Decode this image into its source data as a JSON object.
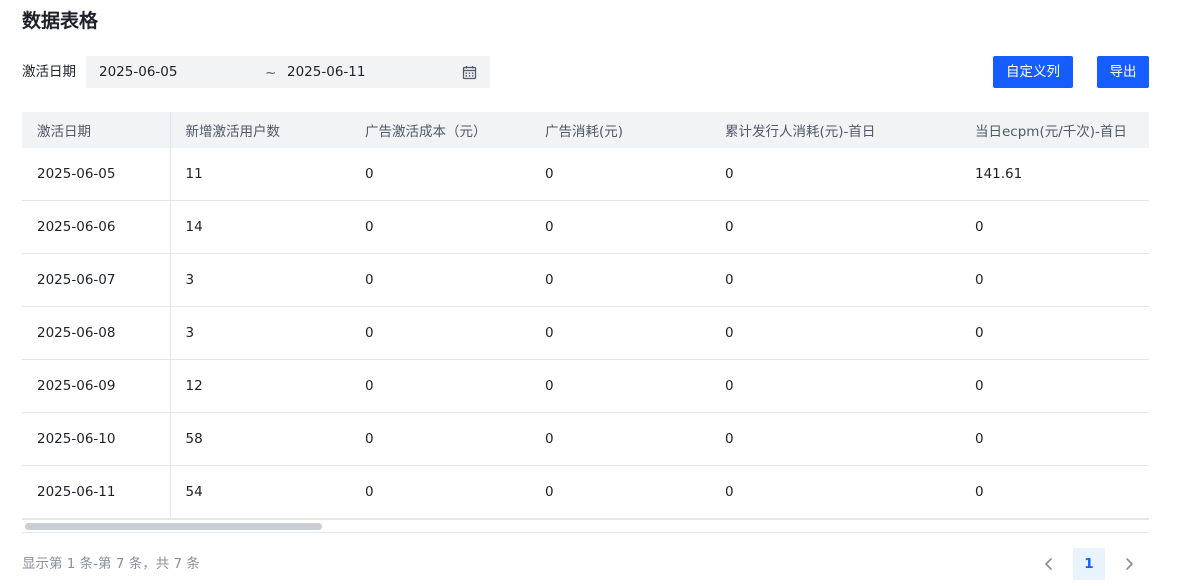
{
  "page": {
    "title": "数据表格"
  },
  "filter": {
    "label": "激活日期",
    "start_date": "2025-06-05",
    "separator": "~",
    "end_date": "2025-06-11",
    "icon": "calendar-icon"
  },
  "toolbar": {
    "custom_columns_label": "自定义列",
    "export_label": "导出"
  },
  "table": {
    "columns": [
      "激活日期",
      "新增激活用户数",
      "广告激活成本（元）",
      "广告消耗(元)",
      "累计发行人消耗(元)-首日",
      "当日ecpm(元/千次)-首日"
    ],
    "rows": [
      [
        "2025-06-05",
        "11",
        "0",
        "0",
        "0",
        "141.61"
      ],
      [
        "2025-06-06",
        "14",
        "0",
        "0",
        "0",
        "0"
      ],
      [
        "2025-06-07",
        "3",
        "0",
        "0",
        "0",
        "0"
      ],
      [
        "2025-06-08",
        "3",
        "0",
        "0",
        "0",
        "0"
      ],
      [
        "2025-06-09",
        "12",
        "0",
        "0",
        "0",
        "0"
      ],
      [
        "2025-06-10",
        "58",
        "0",
        "0",
        "0",
        "0"
      ],
      [
        "2025-06-11",
        "54",
        "0",
        "0",
        "0",
        "0"
      ]
    ],
    "horizontal_scroll_position": 0
  },
  "pagination": {
    "summary": "显示第 1 条-第 7 条，共 7 条",
    "current_page": "1",
    "prev_icon": "chevron-left-icon",
    "next_icon": "chevron-right-icon"
  },
  "colors": {
    "primary": "#165dff",
    "header_bg": "#f2f3f5",
    "border": "#e5e6eb",
    "text": "#1d2129",
    "muted_text": "#86909c"
  }
}
